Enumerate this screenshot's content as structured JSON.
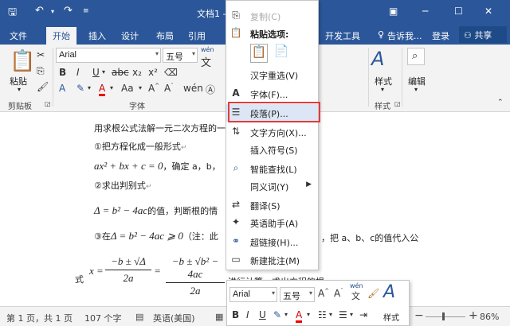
{
  "app": {
    "title": "文档1 -"
  },
  "tabs": [
    "文件",
    "开始",
    "插入",
    "设计",
    "布局",
    "引用",
    "开发工具"
  ],
  "tell_me": "告诉我...",
  "login": "登录",
  "share": "共享",
  "ribbon": {
    "paste_label": "粘贴",
    "clipboard_label": "剪贴板",
    "font_label": "字体",
    "font_name": "Arial",
    "font_size": "五号",
    "wen": "wén",
    "styles_label": "样式",
    "edit_label": "编辑"
  },
  "document": {
    "line1": "用求根公式法解一元二次方程的一",
    "line2": "①把方程化成一般形式",
    "eq1": "ax² + bx + c = 0",
    "line3_tail": "，确定 a，b，",
    "line4": "②求出判别式",
    "eq2": "Δ = b² − 4ac",
    "line5_tail": "的值，判断根的情",
    "line6_pre": "③在",
    "eq3": "Δ = b² − 4ac ⩾ 0",
    "line6_mid": "（注：此",
    "line6_tail": "，把 a、b、c的值代入公",
    "line7_pre": "式",
    "frac1_num": "−b ± √Δ",
    "frac1_den": "2a",
    "frac2_num": "−b ± √b² − 4ac",
    "frac2_den": "2a",
    "line7_tail": "进行计算，求出方程的根。"
  },
  "context_menu": {
    "items": [
      {
        "label": "复制(C)",
        "disabled": true
      },
      {
        "label": "粘贴选项:"
      },
      {
        "label": "汉字重选(V)"
      },
      {
        "label": "字体(F)..."
      },
      {
        "label": "段落(P)..."
      },
      {
        "label": "文字方向(X)..."
      },
      {
        "label": "插入符号(S)"
      },
      {
        "label": "智能查找(L)"
      },
      {
        "label": "同义词(Y)"
      },
      {
        "label": "翻译(S)"
      },
      {
        "label": "英语助手(A)"
      },
      {
        "label": "超链接(H)..."
      },
      {
        "label": "新建批注(M)"
      }
    ]
  },
  "mini_toolbar": {
    "font_name": "Arial",
    "font_size": "五号",
    "wen": "wén",
    "styles_label": "样式"
  },
  "status": {
    "page": "第 1 页，共 1 页",
    "words": "107 个字",
    "lang": "英语(美国)",
    "zoom": "86%"
  },
  "colors": {
    "brand": "#2b579a",
    "highlight": "#e03c3c"
  }
}
